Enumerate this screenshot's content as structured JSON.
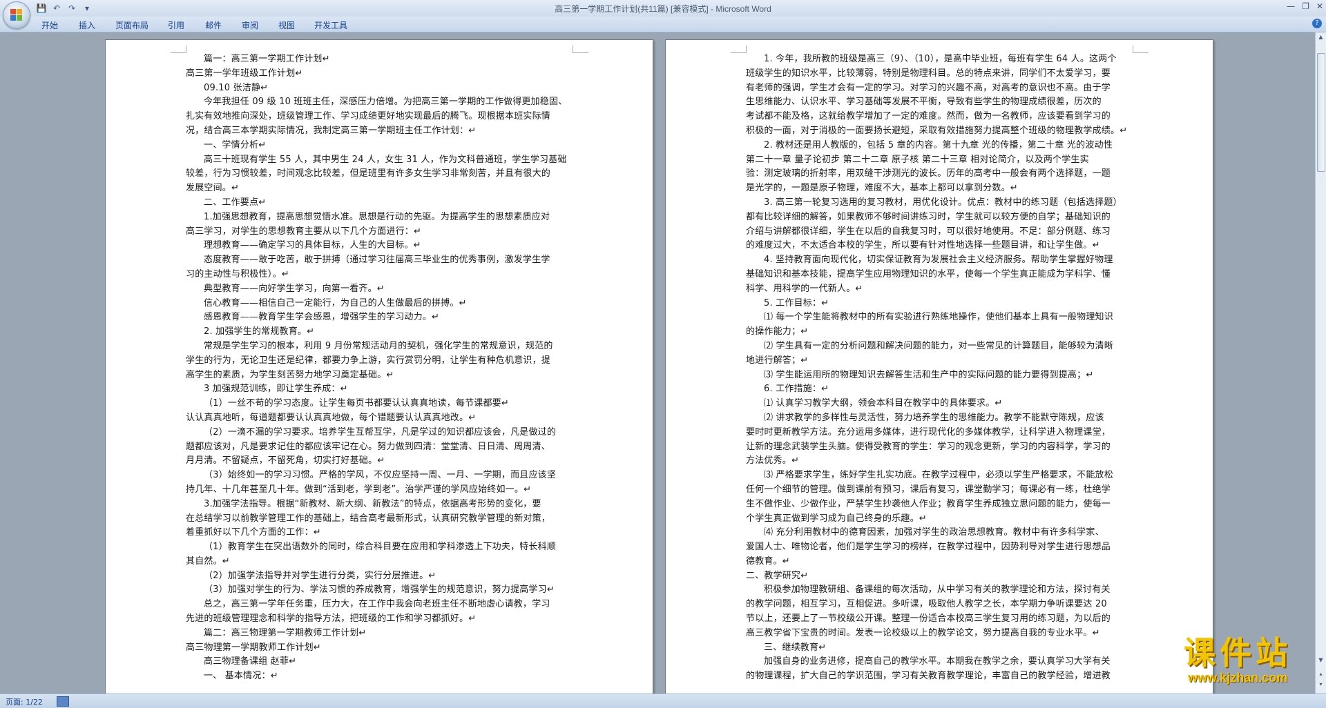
{
  "window": {
    "title": "高三第一学期工作计划(共11篇) [兼容模式] - Microsoft Word",
    "quick_access": [
      "💾",
      "↶",
      "↷",
      "▾"
    ],
    "controls": [
      "—",
      "❐",
      "✕"
    ]
  },
  "ribbon": {
    "tabs": [
      "开始",
      "插入",
      "页面布局",
      "引用",
      "邮件",
      "审阅",
      "视图",
      "开发工具"
    ],
    "help": "?"
  },
  "page_left": [
    {
      "t": "篇一：高三第一学期工作计划↵",
      "ind": true
    },
    {
      "t": "高三第一学年班级工作计划↵",
      "ind": false
    },
    {
      "t": "09.10 张洁静↵",
      "ind": true
    },
    {
      "t": "今年我担任 09 级 10 班班主任，深感压力倍增。为把高三第一学期的工作做得更加稳固、",
      "ind": true
    },
    {
      "t": "扎实有效地推向深处，班级管理工作、学习成绩更好地实现最后的腾飞。现根据本班实际情",
      "ind": false
    },
    {
      "t": "况，结合高三本学期实际情况，我制定高三第一学期班主任工作计划：↵",
      "ind": false
    },
    {
      "t": "一、学情分析↵",
      "ind": true
    },
    {
      "t": "高三十班现有学生 55 人，其中男生 24 人，女生 31 人，作为文科普通班，学生学习基础",
      "ind": true
    },
    {
      "t": "较差，行为习惯较差，时间观念比较差，但是班里有许多女生学习非常刻苦，并且有很大的",
      "ind": false
    },
    {
      "t": "发展空间。↵",
      "ind": false
    },
    {
      "t": "二、工作要点↵",
      "ind": true
    },
    {
      "t": "1.加强思想教育，提高思想觉悟水准。思想是行动的先驱。为提高学生的思想素质应对",
      "ind": true
    },
    {
      "t": "高三学习，对学生的思想教育主要从以下几个方面进行：↵",
      "ind": false
    },
    {
      "t": "理想教育——确定学习的具体目标，人生的大目标。↵",
      "ind": true
    },
    {
      "t": "态度教育——敢于吃苦，敢于拼搏（通过学习往届高三毕业生的优秀事例，激发学生学",
      "ind": true
    },
    {
      "t": "习的主动性与积极性）。↵",
      "ind": false
    },
    {
      "t": "典型教育——向好学生学习，向第一看齐。↵",
      "ind": true
    },
    {
      "t": "信心教育——相信自己一定能行，为自己的人生做最后的拼搏。↵",
      "ind": true
    },
    {
      "t": "感恩教育——教育学生学会感恩，增强学生的学习动力。↵",
      "ind": true
    },
    {
      "t": "2. 加强学生的常规教育。↵",
      "ind": true
    },
    {
      "t": "常规是学生学习的根本，利用 9 月份常规活动月的契机，强化学生的常规意识，规范的",
      "ind": true
    },
    {
      "t": "学生的行为，无论卫生还是纪律，都要力争上游，实行赏罚分明，让学生有种危机意识，提",
      "ind": false
    },
    {
      "t": "高学生的素质，为学生刻苦努力地学习奠定基础。↵",
      "ind": false
    },
    {
      "t": "3 加强规范训练，即让学生养成：↵",
      "ind": true
    },
    {
      "t": "（1）一丝不苟的学习态度。让学生每页书都要认认真真地读，每节课都要↵",
      "ind": true
    },
    {
      "t": "认认真真地听，每道题都要认认真真地做，每个错题要认认真真地改。↵",
      "ind": false
    },
    {
      "t": "（2）一滴不漏的学习要求。培养学生互帮互学，凡是学过的知识都应该会，凡是做过的",
      "ind": true
    },
    {
      "t": "题都应该对，凡是要求记住的都应该牢记在心。努力做到四清：堂堂清、日日清、周周清、",
      "ind": false
    },
    {
      "t": "月月清。不留疑点，不留死角，切实打好基础。↵",
      "ind": false
    },
    {
      "t": "（3）始终如一的学习习惯。严格的学风，不仅应坚持一周、一月、一学期，而且应该坚",
      "ind": true
    },
    {
      "t": "持几年、十几年甚至几十年。做到“活到老，学到老”。治学严谨的学风应始终如一。↵",
      "ind": false
    },
    {
      "t": "3.加强学法指导。根据“新教材、新大纲、新教法”的特点，依据高考形势的变化，要",
      "ind": true
    },
    {
      "t": "在总结学习以前教学管理工作的基础上，结合高考最新形式，认真研究教学管理的新对策，",
      "ind": false
    },
    {
      "t": "着重抓好以下几个方面的工作：↵",
      "ind": false
    },
    {
      "t": "（1）教育学生在突出语数外的同时，综合科目要在应用和学科渗透上下功夫，特长科顺",
      "ind": true
    },
    {
      "t": "其自然。↵",
      "ind": false
    },
    {
      "t": "（2）加强学法指导并对学生进行分类，实行分层推进。↵",
      "ind": true
    },
    {
      "t": "（3）加强对学生的行为、学法习惯的养成教育，增强学生的规范意识，努力提高学习↵",
      "ind": true
    },
    {
      "t": "总之，高三第一学年任务重，压力大，在工作中我会向老班主任不断地虚心请教，学习",
      "ind": true
    },
    {
      "t": "先进的班级管理理念和科学的指导方法，把班级的工作和学习都抓好。↵",
      "ind": false
    },
    {
      "t": "篇二：高三物理第一学期教师工作计划↵",
      "ind": true
    },
    {
      "t": "高三物理第一学期教师工作计划↵",
      "ind": false
    },
    {
      "t": "高三物理备课组 赵菲↵",
      "ind": true
    },
    {
      "t": "一、  基本情况：↵",
      "ind": true
    }
  ],
  "page_right": [
    {
      "t": "1. 今年，我所教的班级是高三（9）、（10），是高中毕业班，每班有学生 64 人。这两个",
      "ind": true
    },
    {
      "t": "班级学生的知识水平，比较薄弱，特别是物理科目。总的特点来讲，同学们不太爱学习，要",
      "ind": false
    },
    {
      "t": "有老师的强调，学生才会有一定的学习。对学习的兴趣不高，对高考的意识也不高。由于学",
      "ind": false
    },
    {
      "t": "生思维能力、认识水平、学习基础等发展不平衡，导致有些学生的物理成绩很差，历次的",
      "ind": false
    },
    {
      "t": "考试都不能及格，这就给教学增加了一定的难度。然而，做为一名教师，应该要看到学习的",
      "ind": false
    },
    {
      "t": "积极的一面，对于消极的一面要扬长避短，采取有效措施努力提高整个班级的物理教学成绩。↵",
      "ind": false
    },
    {
      "t": "2. 教材还是用人教版的，包括 5 章的内容。第十九章 光的传播，第二十章 光的波动性",
      "ind": true
    },
    {
      "t": "第二十一章 量子论初步 第二十二章 原子核  第二十三章  相对论简介，以及两个学生实",
      "ind": false
    },
    {
      "t": "验：测定玻璃的折射率，用双缝干涉测光的波长。历年的高考中一般会有两个选择题，一题",
      "ind": false
    },
    {
      "t": "是光学的，一题是原子物理，难度不大，基本上都可以拿到分数。↵",
      "ind": false
    },
    {
      "t": "3. 高三第一轮复习选用的复习教材，用优化设计。优点：教材中的练习题（包括选择题）",
      "ind": true
    },
    {
      "t": "都有比较详细的解答，如果教师不够时间讲练习时，学生就可以较方便的自学；基础知识的",
      "ind": false
    },
    {
      "t": "介绍与讲解都很详细，学生在以后的自我复习时，可以很好地使用。不足：部分例题、练习",
      "ind": false
    },
    {
      "t": "的难度过大，不太适合本校的学生，所以要有针对性地选择一些题目讲，和让学生做。↵",
      "ind": false
    },
    {
      "t": "4. 坚持教育面向现代化，切实保证教育为发展社会主义经济服务。帮助学生掌握好物理",
      "ind": true
    },
    {
      "t": "基础知识和基本技能，提高学生应用物理知识的水平，使每一个学生真正能成为学科学、懂",
      "ind": false
    },
    {
      "t": "科学、用科学的一代新人。↵",
      "ind": false
    },
    {
      "t": "5. 工作目标：↵",
      "ind": true
    },
    {
      "t": "⑴ 每一个学生能将教材中的所有实验进行熟练地操作，使他们基本上具有一般物理知识",
      "ind": true
    },
    {
      "t": "的操作能力；↵",
      "ind": false
    },
    {
      "t": "⑵ 学生具有一定的分析问题和解决问题的能力，对一些常见的计算题目，能够较为清晰",
      "ind": true
    },
    {
      "t": "地进行解答；↵",
      "ind": false
    },
    {
      "t": "⑶ 学生能运用所的物理知识去解答生活和生产中的实际问题的能力要得到提高；↵",
      "ind": true
    },
    {
      "t": "6. 工作措施：↵",
      "ind": true
    },
    {
      "t": "⑴ 认真学习教学大纲，领会本科目在教学中的具体要求。↵",
      "ind": true
    },
    {
      "t": "⑵  讲求教学的多样性与灵活性，努力培养学生的思维能力。教学不能默守陈规，应该",
      "ind": true
    },
    {
      "t": "要时时更新教学方法。充分运用多媒体，进行现代化的多媒体教学，让科学进入物理课堂，",
      "ind": false
    },
    {
      "t": "让新的理念武装学生头脑。使得受教育的学生：学习的观念更新，学习的内容科学，学习的",
      "ind": false
    },
    {
      "t": "方法优秀。↵",
      "ind": false
    },
    {
      "t": "⑶ 严格要求学生，练好学生扎实功底。在教学过程中，必须以学生严格要求，不能放松",
      "ind": true
    },
    {
      "t": "任何一个细节的管理。做到课前有预习，课后有复习，课堂勤学习；每课必有一练，杜绝学",
      "ind": false
    },
    {
      "t": "生不做作业、少做作业，严禁学生抄袭他人作业；教育学生养成独立思问题的能力，使每一",
      "ind": false
    },
    {
      "t": "个学生真正做到学习成为自己终身的乐趣。↵",
      "ind": false
    },
    {
      "t": "⑷  充分利用教材中的德育因素，加强对学生的政治思想教育。教材中有许多科学家、",
      "ind": true
    },
    {
      "t": "爱国人士、唯物论者，他们是学生学习的榜样，在教学过程中，因势利导对学生进行思想品",
      "ind": false
    },
    {
      "t": "德教育。↵",
      "ind": false
    },
    {
      "t": "二、教学研究↵",
      "ind": false
    },
    {
      "t": "积极参加物理教研组、备课组的每次活动，从中学习有关的教学理论和方法，探讨有关",
      "ind": true
    },
    {
      "t": "的教学问题，相互学习，互相促进。多听课，吸取他人教学之长，本学期力争听课要达 20",
      "ind": false
    },
    {
      "t": "节以上，还要上了一节校级公开课。整理一份适合本校高三学生复习用的练习题，为以后的",
      "ind": false
    },
    {
      "t": "高三教学省下宝贵的时间。发表一论校级以上的教学论文，努力提高自我的专业水平。↵",
      "ind": false
    },
    {
      "t": "三、继续教育↵",
      "ind": true
    },
    {
      "t": "加强自身的业务进修，提高自己的教学水平。本期我在教学之余，要认真学习大学有关",
      "ind": true
    },
    {
      "t": "的物理课程，扩大自己的学识范围，学习有关教育教学理论，丰富自己的教学经验，增进教",
      "ind": false
    }
  ],
  "statusbar": {
    "page_info": "页面: 1/22"
  },
  "watermark": {
    "main": "课件站",
    "url": "www.kjzhan.com"
  }
}
